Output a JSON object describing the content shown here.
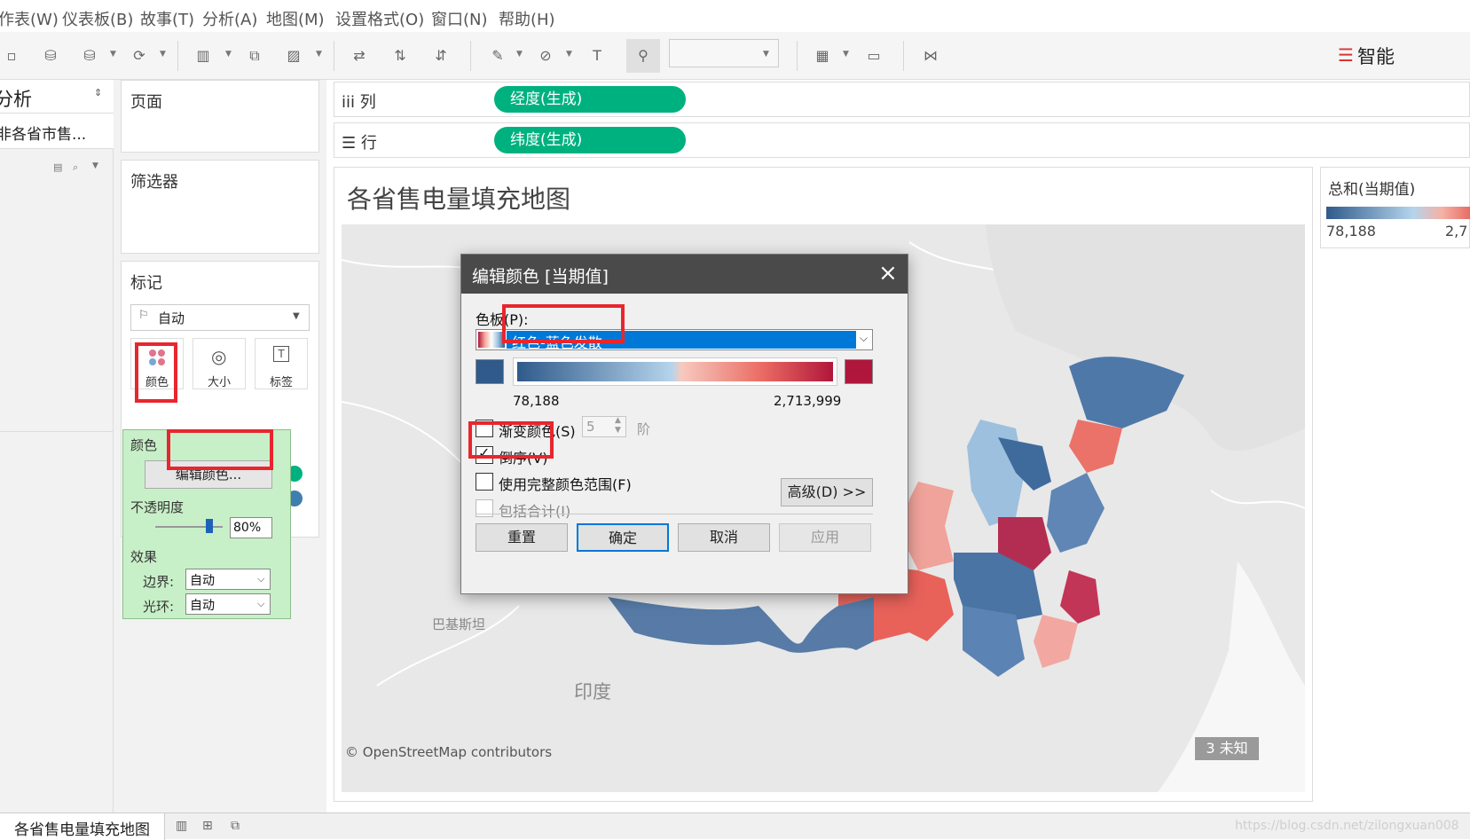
{
  "menu": [
    "作表(W)",
    "仪表板(B)",
    "故事(T)",
    "分析(A)",
    "地图(M)",
    "设置格式(O)",
    "窗口(N)",
    "帮助(H)"
  ],
  "toolbar": {
    "smart_label": "智能"
  },
  "left_panel": {
    "title": "分析",
    "datasource": "非各省市售..."
  },
  "cards": {
    "pages_title": "页面",
    "filters_title": "筛选器",
    "marks_title": "标记",
    "mark_type": "自动",
    "mark_buttons": [
      "颜色",
      "大小",
      "标签"
    ]
  },
  "color_popup": {
    "title": "颜色",
    "edit_button": "编辑颜色...",
    "opacity_label": "不透明度",
    "opacity_value": "80%",
    "opacity_level": 0.8,
    "effects_label": "效果",
    "border_label": "边界:",
    "border_value": "自动",
    "halo_label": "光环:",
    "halo_value": "自动"
  },
  "shelves": {
    "columns_label": "列",
    "columns_pill": "经度(生成)",
    "rows_label": "行",
    "rows_pill": "纬度(生成)"
  },
  "sheet": {
    "title": "各省售电量填充地图",
    "map_labels": {
      "pakistan": "巴基斯坦",
      "india": "印度",
      "attribution": "© OpenStreetMap contributors",
      "unknown": "3 未知"
    }
  },
  "legend": {
    "title": "总和(当期值)",
    "min": "78,188",
    "max": "2,7"
  },
  "dialog": {
    "title": "编辑颜色 [当期值]",
    "palette_label": "色板(P):",
    "palette_value": "红色-蓝色发散",
    "range_min": "78,188",
    "range_max": "2,713,999",
    "stepped_label": "渐变颜色(S)",
    "stepped_checked": false,
    "steps_value": "5",
    "steps_unit": "阶",
    "reverse_label": "倒序(V)",
    "reverse_checked": true,
    "full_range_label": "使用完整颜色范围(F)",
    "full_range_checked": false,
    "include_totals_label": "包括合计(I)",
    "include_totals_checked": false,
    "advanced_button": "高级(D) >>",
    "reset_button": "重置",
    "ok_button": "确定",
    "cancel_button": "取消",
    "apply_button": "应用"
  },
  "bottom": {
    "sheet_tab": "各省售电量填充地图",
    "watermark": "https://blog.csdn.net/zilongxuan008"
  },
  "colors": {
    "pill_green": "#00b180",
    "low_blue": "#2f5a8a",
    "high_red": "#b0163b",
    "highlight_red": "#e8262d",
    "select_blue": "#0078d7"
  }
}
